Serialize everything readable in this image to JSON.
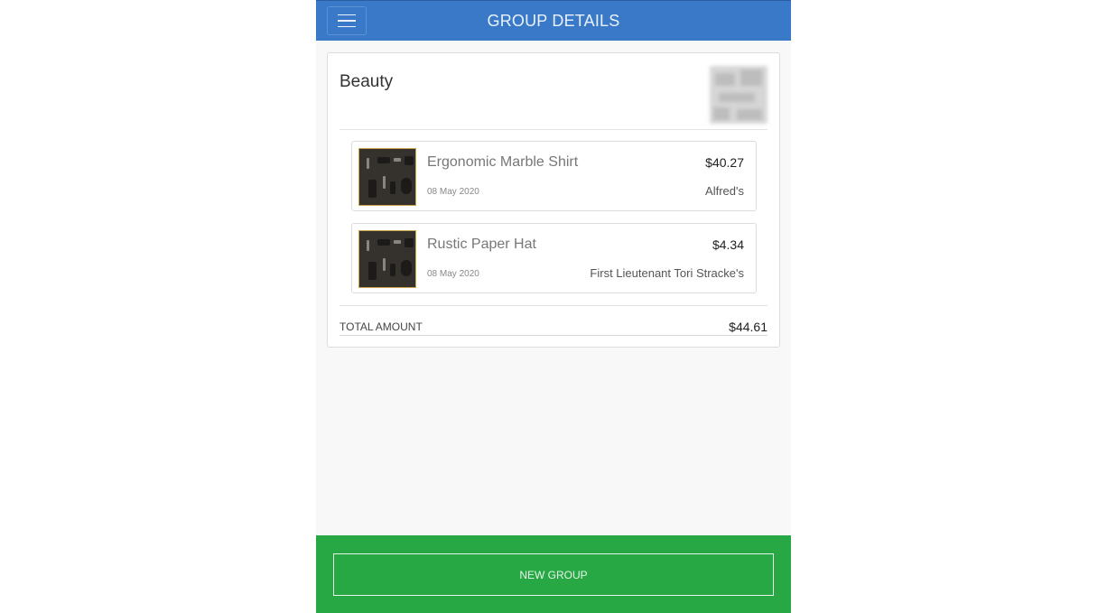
{
  "header": {
    "title": "GROUP DETAILS",
    "menu_icon": "hamburger-menu-icon"
  },
  "group": {
    "name": "Beauty",
    "items": [
      {
        "name": "Ergonomic Marble Shirt",
        "date": "08 May 2020",
        "price": "$40.27",
        "store": "Alfred's"
      },
      {
        "name": "Rustic Paper Hat",
        "date": "08 May 2020",
        "price": "$4.34",
        "store": "First Lieutenant Tori Stracke's"
      }
    ],
    "total_label": "TOTAL AMOUNT",
    "total_value": "$44.61"
  },
  "footer": {
    "new_group_label": "NEW GROUP"
  },
  "colors": {
    "header": "#3a79c8",
    "footer": "#28a745",
    "background": "#f8f8f8"
  }
}
